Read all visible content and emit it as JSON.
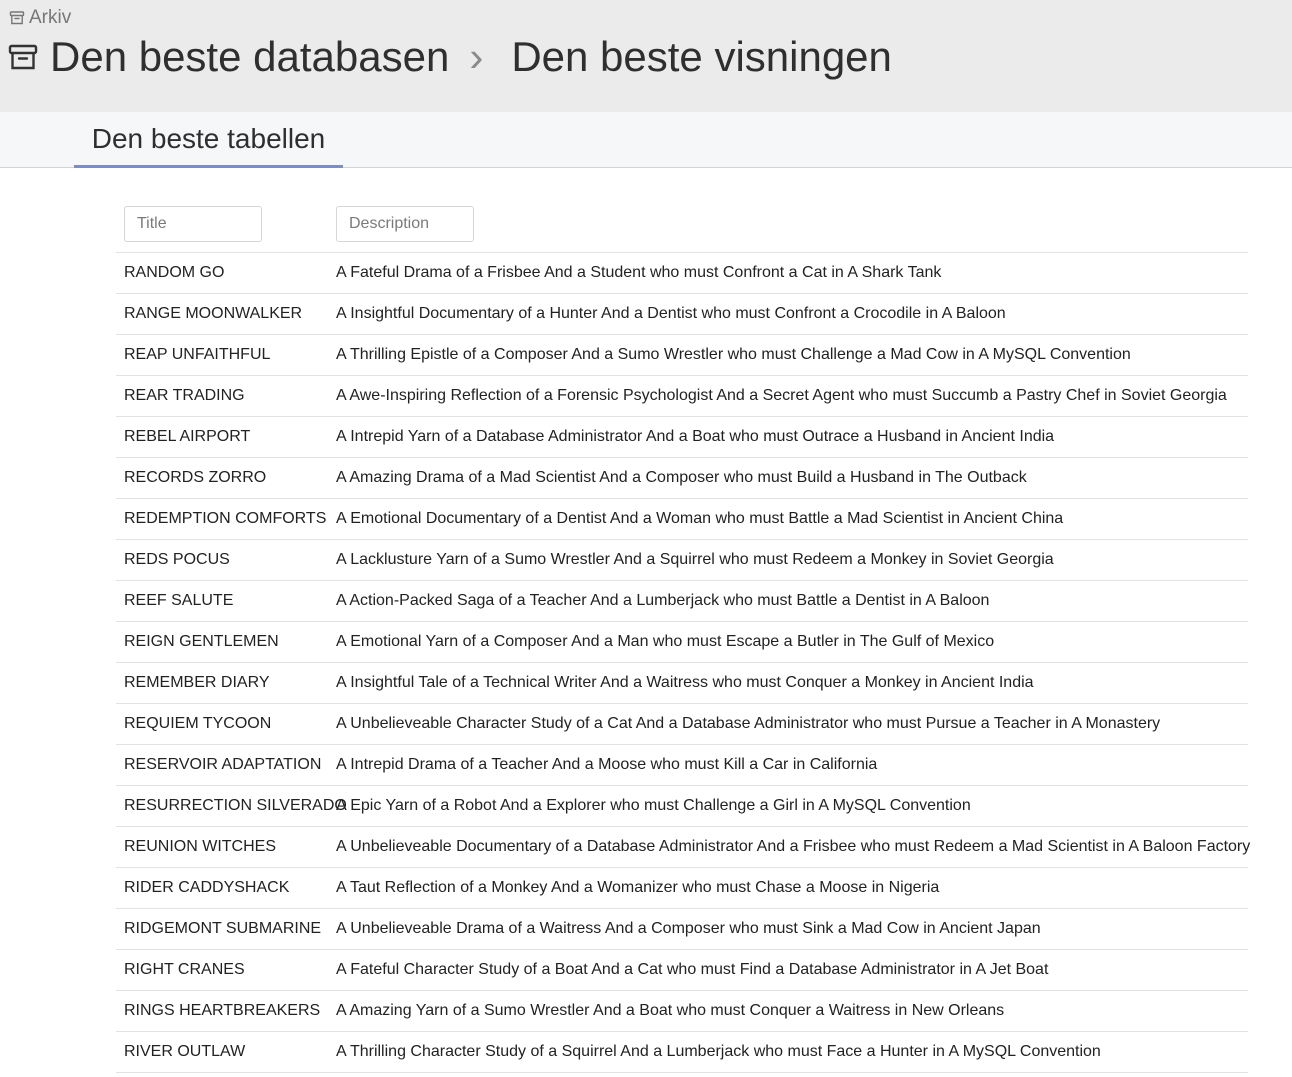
{
  "header": {
    "archive_label": "Arkiv",
    "database_name": "Den beste databasen",
    "view_name": "Den beste visningen",
    "separator": "›"
  },
  "tabs": [
    {
      "label": "Den beste tabellen",
      "active": true
    }
  ],
  "table": {
    "filters": {
      "title_placeholder": "Title",
      "description_placeholder": "Description"
    },
    "rows": [
      {
        "title": "RANDOM GO",
        "description": "A Fateful Drama of a Frisbee And a Student who must Confront a Cat in A Shark Tank"
      },
      {
        "title": "RANGE MOONWALKER",
        "description": "A Insightful Documentary of a Hunter And a Dentist who must Confront a Crocodile in A Baloon"
      },
      {
        "title": "REAP UNFAITHFUL",
        "description": "A Thrilling Epistle of a Composer And a Sumo Wrestler who must Challenge a Mad Cow in A MySQL Convention"
      },
      {
        "title": "REAR TRADING",
        "description": "A Awe-Inspiring Reflection of a Forensic Psychologist And a Secret Agent who must Succumb a Pastry Chef in Soviet Georgia"
      },
      {
        "title": "REBEL AIRPORT",
        "description": "A Intrepid Yarn of a Database Administrator And a Boat who must Outrace a Husband in Ancient India"
      },
      {
        "title": "RECORDS ZORRO",
        "description": "A Amazing Drama of a Mad Scientist And a Composer who must Build a Husband in The Outback"
      },
      {
        "title": "REDEMPTION COMFORTS",
        "description": "A Emotional Documentary of a Dentist And a Woman who must Battle a Mad Scientist in Ancient China"
      },
      {
        "title": "REDS POCUS",
        "description": "A Lacklusture Yarn of a Sumo Wrestler And a Squirrel who must Redeem a Monkey in Soviet Georgia"
      },
      {
        "title": "REEF SALUTE",
        "description": "A Action-Packed Saga of a Teacher And a Lumberjack who must Battle a Dentist in A Baloon"
      },
      {
        "title": "REIGN GENTLEMEN",
        "description": "A Emotional Yarn of a Composer And a Man who must Escape a Butler in The Gulf of Mexico"
      },
      {
        "title": "REMEMBER DIARY",
        "description": "A Insightful Tale of a Technical Writer And a Waitress who must Conquer a Monkey in Ancient India"
      },
      {
        "title": "REQUIEM TYCOON",
        "description": "A Unbelieveable Character Study of a Cat And a Database Administrator who must Pursue a Teacher in A Monastery"
      },
      {
        "title": "RESERVOIR ADAPTATION",
        "description": "A Intrepid Drama of a Teacher And a Moose who must Kill a Car in California"
      },
      {
        "title": "RESURRECTION SILVERADO",
        "description": "A Epic Yarn of a Robot And a Explorer who must Challenge a Girl in A MySQL Convention"
      },
      {
        "title": "REUNION WITCHES",
        "description": "A Unbelieveable Documentary of a Database Administrator And a Frisbee who must Redeem a Mad Scientist in A Baloon Factory"
      },
      {
        "title": "RIDER CADDYSHACK",
        "description": "A Taut Reflection of a Monkey And a Womanizer who must Chase a Moose in Nigeria"
      },
      {
        "title": "RIDGEMONT SUBMARINE",
        "description": "A Unbelieveable Drama of a Waitress And a Composer who must Sink a Mad Cow in Ancient Japan"
      },
      {
        "title": "RIGHT CRANES",
        "description": "A Fateful Character Study of a Boat And a Cat who must Find a Database Administrator in A Jet Boat"
      },
      {
        "title": "RINGS HEARTBREAKERS",
        "description": "A Amazing Yarn of a Sumo Wrestler And a Boat who must Conquer a Waitress in New Orleans"
      },
      {
        "title": "RIVER OUTLAW",
        "description": "A Thrilling Character Study of a Squirrel And a Lumberjack who must Face a Hunter in A MySQL Convention"
      }
    ]
  },
  "colors": {
    "header_bg": "#ebebeb",
    "tabs_bg": "#f6f7f9",
    "active_tab_underline": "#7a8fc5",
    "row_divider": "#e2e2e2"
  },
  "icons": {
    "archive": "archive-box-icon",
    "separator": "chevron-right-icon"
  }
}
